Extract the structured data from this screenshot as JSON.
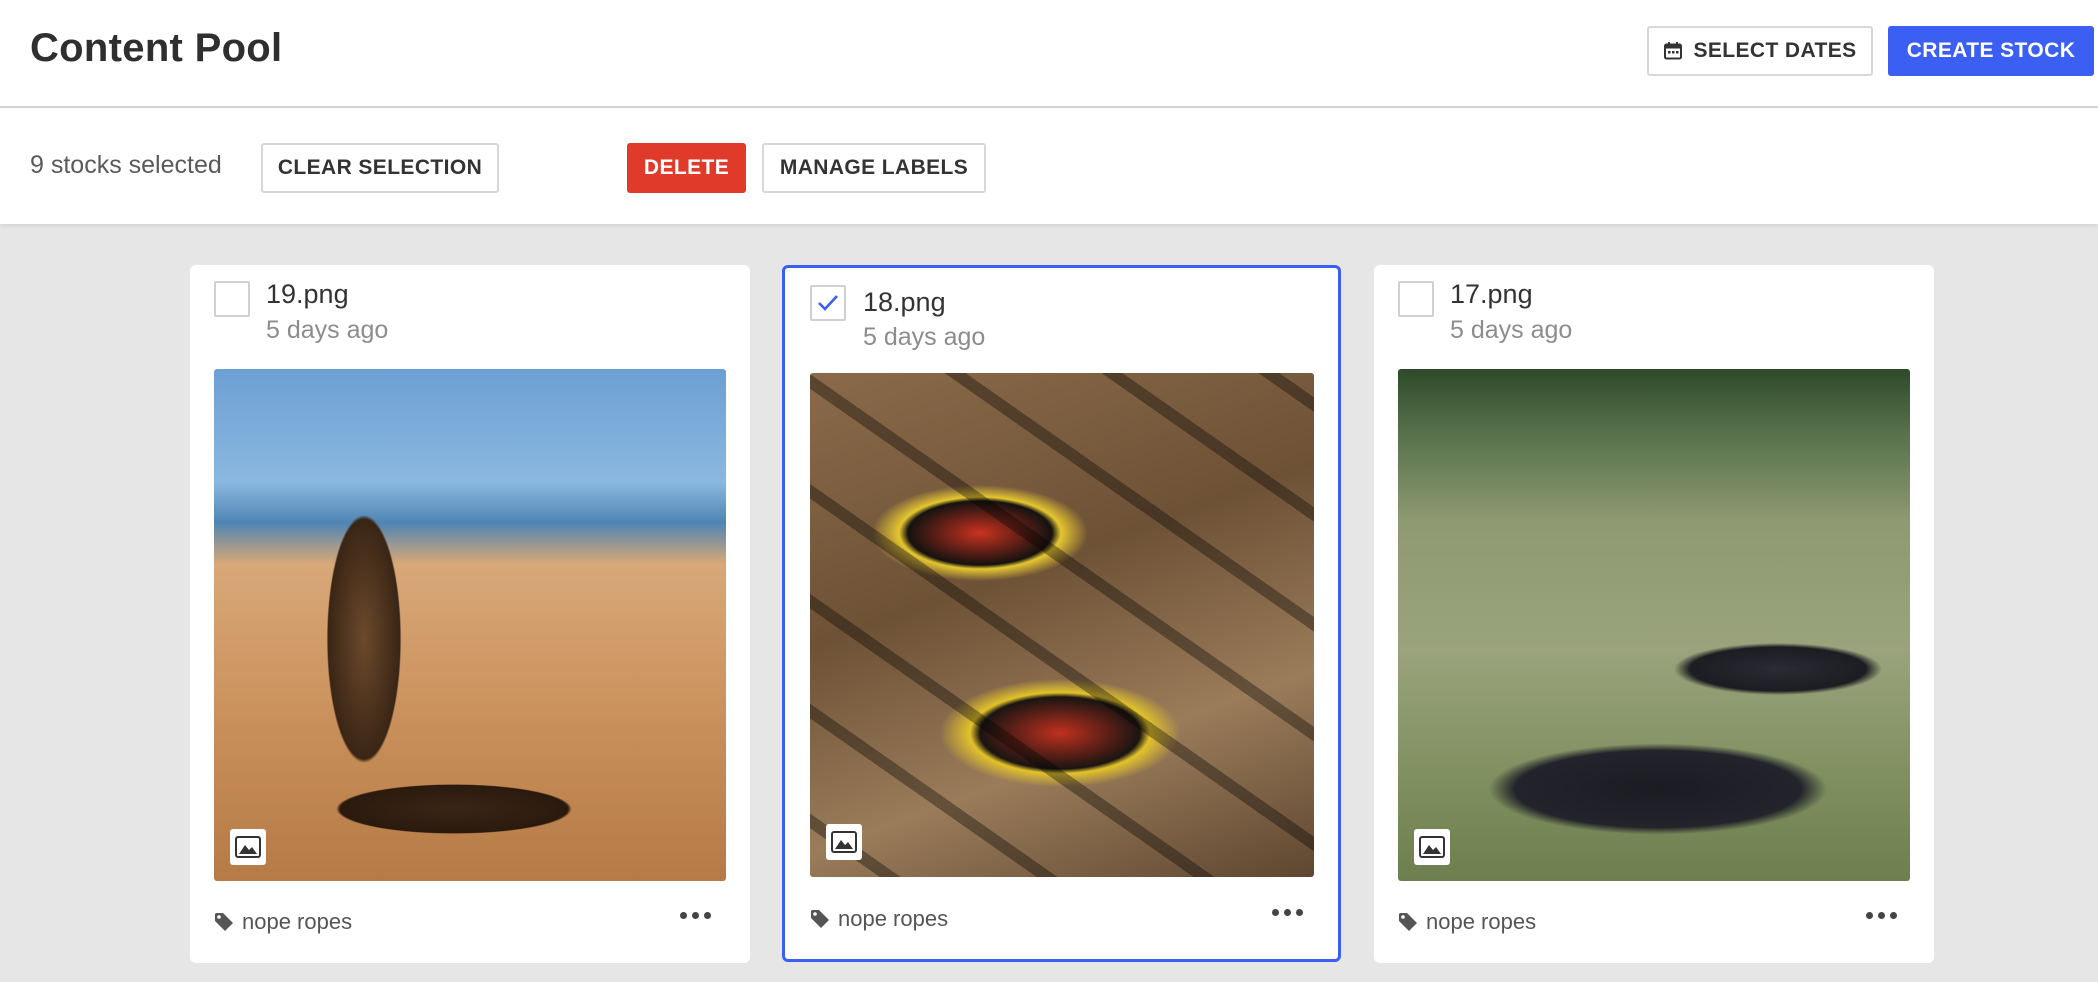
{
  "header": {
    "title": "Content Pool",
    "select_dates_label": "SELECT DATES",
    "create_stock_label": "CREATE STOCK"
  },
  "selection_bar": {
    "count_text": "9 stocks selected",
    "clear_label": "CLEAR SELECTION",
    "delete_label": "DELETE",
    "manage_labels_label": "MANAGE LABELS"
  },
  "cards": [
    {
      "filename": "19.png",
      "date": "5 days ago",
      "label": "nope ropes",
      "selected": false,
      "image_icon": "image-icon"
    },
    {
      "filename": "18.png",
      "date": "5 days ago",
      "label": "nope ropes",
      "selected": true,
      "image_icon": "image-icon"
    },
    {
      "filename": "17.png",
      "date": "5 days ago",
      "label": "nope ropes",
      "selected": false,
      "image_icon": "image-icon"
    }
  ],
  "colors": {
    "primary": "#3b5ef3",
    "danger": "#e03a2b",
    "background": "#e6e6e6"
  }
}
